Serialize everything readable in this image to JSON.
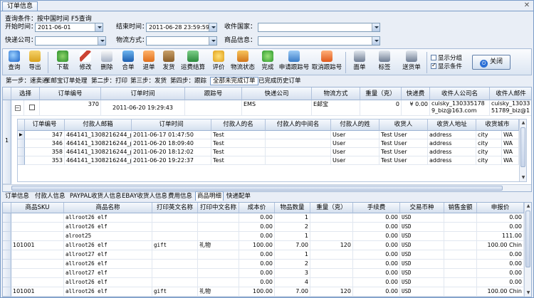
{
  "window": {
    "title": "订单信息",
    "close_glyph": "✕"
  },
  "query": {
    "hint": "查询条件：按中国时间   F5查询",
    "start_label": "开始时间：",
    "start_value": "2011-06-01",
    "end_label": "结束时间：",
    "end_value": "2011-06-28 23:59:59",
    "country_label": "收件国家：",
    "country_value": "",
    "express_label": "快递公司：",
    "express_value": "",
    "logistics_label": "物流方式：",
    "logistics_value": "",
    "goods_label": "商品信息：",
    "goods_value": ""
  },
  "toolbar": {
    "items": [
      {
        "label": "查询",
        "icon": "search-icon"
      },
      {
        "label": "导出",
        "icon": "export-icon"
      },
      {
        "label": "下载",
        "icon": "download-icon"
      },
      {
        "label": "修改",
        "icon": "edit-icon"
      },
      {
        "label": "删除",
        "icon": "delete-icon"
      },
      {
        "label": "合单",
        "icon": "merge-icon"
      },
      {
        "label": "退单",
        "icon": "return-icon"
      },
      {
        "label": "发货",
        "icon": "ship-icon"
      },
      {
        "label": "运费结算",
        "icon": "freight-icon"
      },
      {
        "label": "评价",
        "icon": "rate-icon"
      },
      {
        "label": "物流状态",
        "icon": "truck-icon"
      },
      {
        "label": "完成",
        "icon": "complete-icon"
      },
      {
        "label": "申请跟踪号",
        "icon": "apply-tracking-icon"
      },
      {
        "label": "取消跟踪号",
        "icon": "cancel-tracking-icon"
      },
      {
        "label": "面单",
        "icon": "printer-icon"
      },
      {
        "label": "标签",
        "icon": "printer-icon"
      },
      {
        "label": "送货单",
        "icon": "printer-icon"
      }
    ],
    "show_group_label": "显示分组",
    "show_filter_label": "显示条件",
    "close_label": "关闭"
  },
  "steps": [
    "第一步：速卖通",
    "E邮宝订单处理",
    "第二步：打印",
    "第三步：发货",
    "第四步：跟踪",
    "全部未完成订单",
    "已完成历史订单"
  ],
  "orders": {
    "headers": [
      "选择",
      "订单编号",
      "订单时间",
      "跟踪号",
      "快递公司",
      "物流方式",
      "重量（克）",
      "快递费",
      "收件人公司名",
      "收件人邮件"
    ],
    "row": {
      "index": "1",
      "expand": "−",
      "order_no": "370",
      "time": "2011-06-20 19:29:43",
      "tracking": "",
      "express": "EMS",
      "logistics": "E邮宝",
      "weight": "0",
      "fee": "¥ 0.00",
      "company": "cuisky_1303351789_biz@163.com",
      "email": "cuisky_1303351789_biz@163.com"
    }
  },
  "detail": {
    "headers": [
      "订单编号",
      "付款人邮箱",
      "订单时间",
      "付款人的名",
      "付款人的中间名",
      "付款人的姓",
      "收货人",
      "收货人地址",
      "收货城市"
    ],
    "rows": [
      [
        "347",
        "464141_1308216244_p",
        "2011-06-17 01:47:50",
        "Test",
        "",
        "User",
        "Test User",
        "address",
        "city",
        "WA"
      ],
      [
        "346",
        "464141_1308216244_p",
        "2011-06-20 18:09:40",
        "Test",
        "",
        "User",
        "Test User",
        "address",
        "city",
        "WA"
      ],
      [
        "358",
        "464141_1308216244_p",
        "2011-06-20 18:12:02",
        "Test",
        "",
        "User",
        "Test User",
        "address",
        "city",
        "WA"
      ],
      [
        "353",
        "464141_1308216244_p",
        "2011-06-20 19:22:37",
        "Test",
        "",
        "User",
        "Test User",
        "address",
        "city",
        "WA"
      ]
    ]
  },
  "bottom_tabs": [
    "订单信息",
    "付款人信息",
    "PAYPAL收货人信息",
    "EBAY收货人信息",
    "费用信息",
    "商品明细",
    "快递配单"
  ],
  "goods": {
    "headers": [
      "商品SKU",
      "商品名称",
      "打印英文名称",
      "打印中文名称",
      "成本价",
      "物品数量",
      "重量（克）",
      "手续费",
      "交易币种",
      "销售金额",
      "申报价"
    ],
    "rows": [
      [
        "",
        "allroot26 elf",
        "",
        "",
        "0.00",
        "1",
        "",
        "0.00",
        "USD",
        "",
        "0.00"
      ],
      [
        "",
        "allroot26 elf",
        "",
        "",
        "0.00",
        "2",
        "",
        "0.00",
        "USD",
        "",
        "0.00"
      ],
      [
        "",
        "alroot25",
        "",
        "",
        "0.00",
        "1",
        "",
        "0.00",
        "USD",
        "",
        "111.00"
      ],
      [
        "101001",
        "allroot26 elf",
        "gift",
        "礼物",
        "100.00",
        "7.00",
        "120",
        "0.00",
        "USD",
        "",
        "100.00 Chin"
      ],
      [
        "",
        "allroot27 elf",
        "",
        "",
        "0.00",
        "1",
        "",
        "0.00",
        "USD",
        "",
        "0.00"
      ],
      [
        "",
        "allroot26 elf",
        "",
        "",
        "0.00",
        "2",
        "",
        "0.00",
        "USD",
        "",
        "0.00"
      ],
      [
        "",
        "allroot27 elf",
        "",
        "",
        "0.00",
        "3",
        "",
        "0.00",
        "USD",
        "",
        "0.00"
      ],
      [
        "",
        "allroot26 elf",
        "",
        "",
        "0.00",
        "4",
        "",
        "0.00",
        "USD",
        "",
        "0.00"
      ],
      [
        "101001",
        "allroot26 elf",
        "gift",
        "礼物",
        "100.00",
        "7.00",
        "120",
        "0.00",
        "USD",
        "",
        "100.00 Chin"
      ]
    ]
  },
  "colors": {
    "accent": "#7a9cc8",
    "toolbar_bg": "#dbe5f2",
    "window_bg": "#e9eef6"
  }
}
